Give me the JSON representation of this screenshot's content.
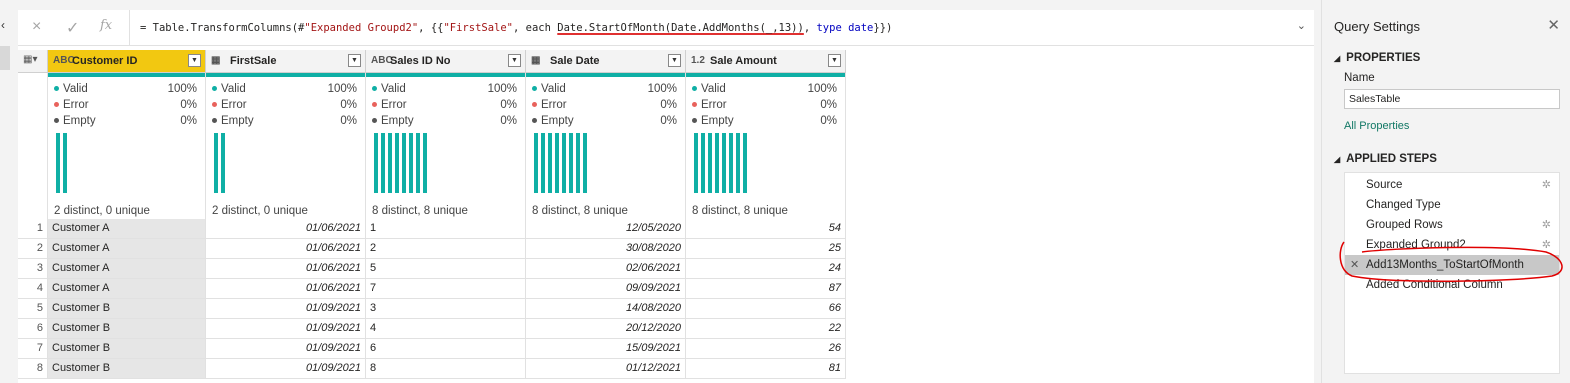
{
  "formula_bar": {
    "cancel_icon": "×",
    "confirm_icon": "✓",
    "fx_label": "fx",
    "formula_part1": "= Table.TransformColumns(#",
    "formula_str1": "\"Expanded Groupd2\"",
    "formula_part2": ", {{",
    "formula_str2": "\"FirstSale\"",
    "formula_part3": ", each ",
    "formula_underlined": "Date.StartOfMonth(Date.AddMonths(_,13))",
    "formula_part4": ", ",
    "formula_kw": "type date",
    "formula_part5": "}})",
    "expand_icon": "⌄"
  },
  "columns": [
    {
      "type_label": "ABC",
      "name": "Customer ID",
      "selected": true,
      "valid": "100%",
      "error": "0%",
      "empty": "0%",
      "distinct": "2 distinct, 0 unique",
      "bars": 2
    },
    {
      "type_label": "▦",
      "name": "FirstSale",
      "selected": false,
      "valid": "100%",
      "error": "0%",
      "empty": "0%",
      "distinct": "2 distinct, 0 unique",
      "bars": 2
    },
    {
      "type_label": "ABC",
      "name": "Sales ID No",
      "selected": false,
      "valid": "100%",
      "error": "0%",
      "empty": "0%",
      "distinct": "8 distinct, 8 unique",
      "bars": 8
    },
    {
      "type_label": "▦",
      "name": "Sale Date",
      "selected": false,
      "valid": "100%",
      "error": "0%",
      "empty": "0%",
      "distinct": "8 distinct, 8 unique",
      "bars": 8
    },
    {
      "type_label": "1.2",
      "name": "Sale Amount",
      "selected": false,
      "valid": "100%",
      "error": "0%",
      "empty": "0%",
      "distinct": "8 distinct, 8 unique",
      "bars": 8
    }
  ],
  "quality_labels": {
    "valid": "Valid",
    "error": "Error",
    "empty": "Empty"
  },
  "colors": {
    "valid": "#0fafa5",
    "error": "#e8625c",
    "empty": "#555555",
    "selected_header": "#f2c811"
  },
  "rows": [
    [
      "1",
      "Customer A",
      "01/06/2021",
      "1",
      "12/05/2020",
      "54"
    ],
    [
      "2",
      "Customer A",
      "01/06/2021",
      "2",
      "30/08/2020",
      "25"
    ],
    [
      "3",
      "Customer A",
      "01/06/2021",
      "5",
      "02/06/2021",
      "24"
    ],
    [
      "4",
      "Customer A",
      "01/06/2021",
      "7",
      "09/09/2021",
      "87"
    ],
    [
      "5",
      "Customer B",
      "01/09/2021",
      "3",
      "14/08/2020",
      "66"
    ],
    [
      "6",
      "Customer B",
      "01/09/2021",
      "4",
      "20/12/2020",
      "22"
    ],
    [
      "7",
      "Customer B",
      "01/09/2021",
      "6",
      "15/09/2021",
      "26"
    ],
    [
      "8",
      "Customer B",
      "01/09/2021",
      "8",
      "01/12/2021",
      "81"
    ]
  ],
  "query_settings": {
    "title": "Query Settings",
    "close_icon": "✕",
    "properties_heading": "PROPERTIES",
    "name_label": "Name",
    "name_value": "SalesTable",
    "all_properties": "All Properties",
    "applied_steps_heading": "APPLIED STEPS",
    "steps": [
      {
        "label": "Source",
        "gear": true,
        "selected": false
      },
      {
        "label": "Changed Type",
        "gear": false,
        "selected": false
      },
      {
        "label": "Grouped Rows",
        "gear": true,
        "selected": false
      },
      {
        "label": "Expanded Groupd2",
        "gear": true,
        "selected": false
      },
      {
        "label": "Add13Months_ToStartOfMonth",
        "gear": false,
        "selected": true
      },
      {
        "label": "Added Conditional Column",
        "gear": false,
        "selected": false
      }
    ]
  }
}
